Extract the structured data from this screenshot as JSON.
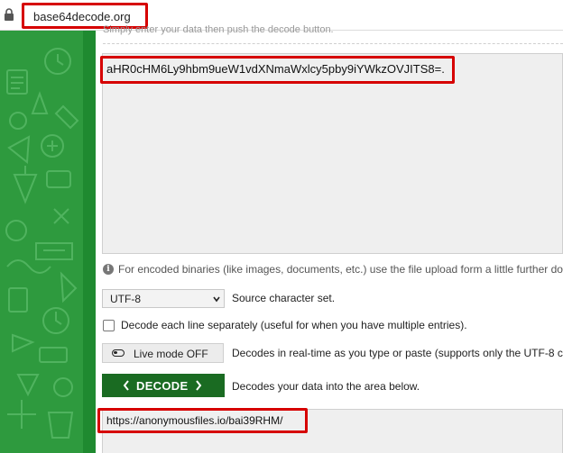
{
  "browser": {
    "url": "base64decode.org"
  },
  "page": {
    "hint": "Simply enter your data then push the decode button.",
    "input_value": "aHR0cHM6Ly9hbm9ueW1vdXNmaWxlcy5pby9iYWkzOVJITS8=.",
    "info": "For encoded binaries (like images, documents, etc.) use the file upload form a little further do",
    "charset": {
      "selected": "UTF-8",
      "label": "Source character set."
    },
    "each_line": {
      "label": "Decode each line separately (useful for when you have multiple entries)."
    },
    "live_mode": {
      "button_label": "Live mode OFF",
      "description": "Decodes in real-time as you type or paste (supports only the UTF-8 c"
    },
    "decode": {
      "button_label": "DECODE",
      "description": "Decodes your data into the area below."
    },
    "output_value": "https://anonymousfiles.io/bai39RHM/"
  },
  "colors": {
    "accent_green": "#1a6b22",
    "side_green": "#2e9a3e",
    "highlight_red": "#d60000"
  },
  "icons": [
    "lock-icon",
    "info-icon",
    "chevron-down-icon",
    "toggle-icon",
    "chevron-left-icon",
    "chevron-right-icon"
  ]
}
